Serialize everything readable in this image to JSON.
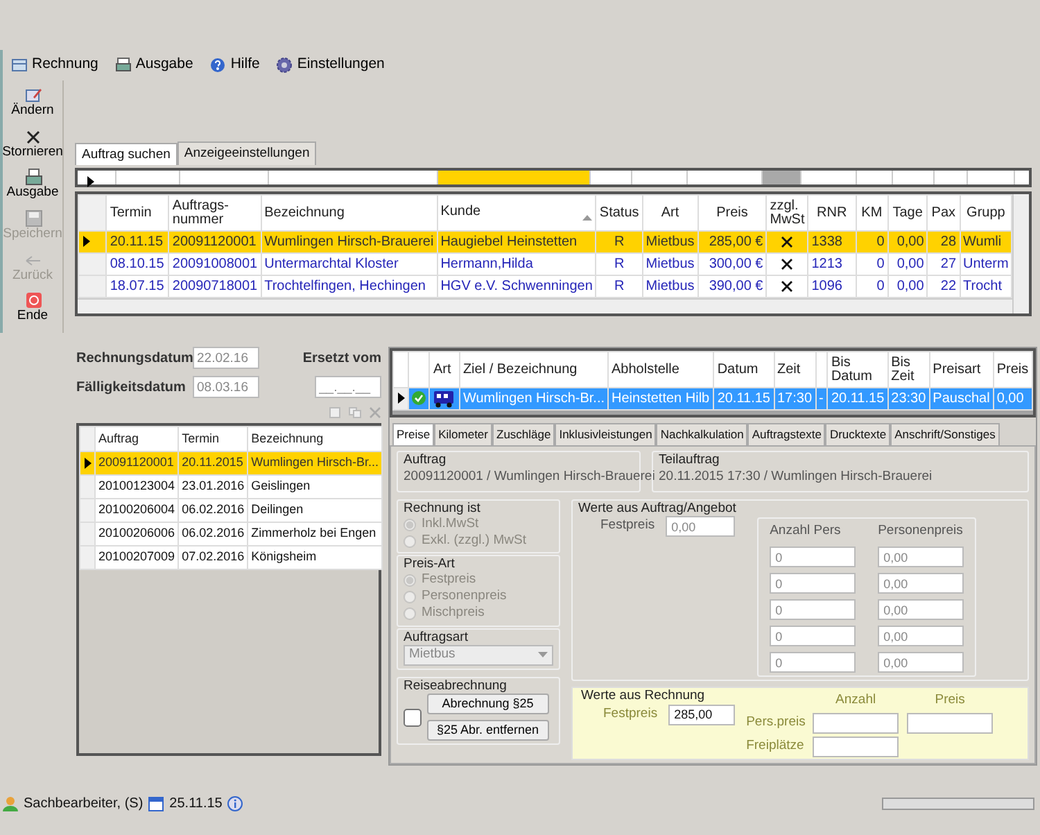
{
  "menu": [
    {
      "label": "Rechnung"
    },
    {
      "label": "Ausgabe"
    },
    {
      "label": "Hilfe"
    },
    {
      "label": "Einstellungen"
    }
  ],
  "toolbar": [
    {
      "label": "Ändern",
      "disabled": false
    },
    {
      "label": "Stornieren",
      "disabled": false
    },
    {
      "label": "Ausgabe",
      "disabled": false
    },
    {
      "label": "Speichern",
      "disabled": true
    },
    {
      "label": "Zurück",
      "disabled": true
    },
    {
      "label": "Ende",
      "disabled": false
    }
  ],
  "search_tabs": [
    {
      "label": "Auftrag suchen",
      "selected": true
    },
    {
      "label": "Anzeigeeinstellungen",
      "selected": false
    }
  ],
  "filter_cells": [
    {
      "kind": "blank"
    },
    {
      "kind": "blank"
    },
    {
      "kind": "blank"
    },
    {
      "kind": "active"
    },
    {
      "kind": "blank"
    },
    {
      "kind": "blank"
    },
    {
      "kind": "blank"
    },
    {
      "kind": "inactive"
    },
    {
      "kind": "blank"
    },
    {
      "kind": "blank"
    },
    {
      "kind": "blank"
    },
    {
      "kind": "blank"
    },
    {
      "kind": "blank"
    }
  ],
  "orders": {
    "columns": [
      {
        "label": "Termin"
      },
      {
        "label": "Auftrags-\nnummer"
      },
      {
        "label": "Bezeichnung"
      },
      {
        "label": "Kunde",
        "sorted": true
      },
      {
        "label": "Status"
      },
      {
        "label": "Art"
      },
      {
        "label": "Preis"
      },
      {
        "label": "zzgl.\nMwSt"
      },
      {
        "label": "RNR"
      },
      {
        "label": "KM"
      },
      {
        "label": "Tage"
      },
      {
        "label": "Pax"
      },
      {
        "label": "Grupp"
      }
    ],
    "rows": [
      {
        "selected": true,
        "termin": "20.11.15",
        "nummer": "20091120001",
        "bezeichnung": "Wumlingen Hirsch-Brauerei",
        "kunde": "Haugiebel Heinstetten",
        "status": "R",
        "art": "Mietbus",
        "preis": "285,00 €",
        "mwst": true,
        "rnr": "1338",
        "km": "0",
        "tage": "0,00",
        "pax": "28",
        "gruppe": "Wumli"
      },
      {
        "selected": false,
        "termin": "08.10.15",
        "nummer": "20091008001",
        "bezeichnung": "Untermarchtal Kloster",
        "kunde": "Hermann,Hilda",
        "status": "R",
        "art": "Mietbus",
        "preis": "300,00 €",
        "mwst": true,
        "rnr": "1213",
        "km": "0",
        "tage": "0,00",
        "pax": "27",
        "gruppe": "Unterm"
      },
      {
        "selected": false,
        "termin": "18.07.15",
        "nummer": "20090718001",
        "bezeichnung": "Trochtelfingen, Hechingen",
        "kunde": "HGV e.V. Schwenningen",
        "status": "R",
        "art": "Mietbus",
        "preis": "390,00 €",
        "mwst": true,
        "rnr": "1096",
        "km": "0",
        "tage": "0,00",
        "pax": "22",
        "gruppe": "Trocht"
      }
    ]
  },
  "invoice": {
    "rechnungsdatum_label": "Rechnungsdatum",
    "rechnungsdatum": "22.02.16",
    "faelligkeit_label": "Fälligkeitsdatum",
    "faelligkeit": "08.03.16",
    "ersetzt_label": "Ersetzt vom",
    "ersetzt": "__.__.__"
  },
  "invoice_orders": {
    "columns": [
      "Auftrag",
      "Termin",
      "Bezeichnung"
    ],
    "rows": [
      {
        "selected": true,
        "cells": [
          "20091120001",
          "20.11.2015",
          "Wumlingen Hirsch-Br..."
        ]
      },
      {
        "selected": false,
        "cells": [
          "20100123004",
          "23.01.2016",
          "Geislingen"
        ]
      },
      {
        "selected": false,
        "cells": [
          "20100206004",
          "06.02.2016",
          "Deilingen"
        ]
      },
      {
        "selected": false,
        "cells": [
          "20100206006",
          "06.02.2016",
          "Zimmerholz bei Engen"
        ]
      },
      {
        "selected": false,
        "cells": [
          "20100207009",
          "07.02.2016",
          "Königsheim"
        ]
      }
    ]
  },
  "positions": {
    "columns": [
      "Art",
      "Ziel / Bezeichnung",
      "Abholstelle",
      "Datum",
      "Zeit",
      "Bis\nDatum",
      "Bis\nZeit",
      "Preisart",
      "Preis"
    ],
    "rows": [
      {
        "selected": true,
        "confirmed": true,
        "ziel": "Wumlingen Hirsch-Br...",
        "abholstelle": "Heinstetten Hilb",
        "datum": "20.11.15",
        "zeit": "17:30",
        "trenner": "-",
        "bis_datum": "20.11.15",
        "bis_zeit": "23:30",
        "preisart": "Pauschal",
        "preis": "0,00"
      }
    ]
  },
  "detail_tabs": [
    {
      "label": "Preise",
      "selected": true
    },
    {
      "label": "Kilometer",
      "selected": false
    },
    {
      "label": "Zuschläge",
      "selected": false
    },
    {
      "label": "Inklusivleistungen",
      "selected": false
    },
    {
      "label": "Nachkalkulation",
      "selected": false
    },
    {
      "label": "Auftragstexte",
      "selected": false
    },
    {
      "label": "Drucktexte",
      "selected": false
    },
    {
      "label": "Anschrift/Sonstiges",
      "selected": false
    }
  ],
  "preise": {
    "auftrag": {
      "title": "Auftrag",
      "value": "20091120001 / Wumlingen Hirsch-Brauerei"
    },
    "teilauftrag": {
      "title": "Teilauftrag",
      "value": "20.11.2015 17:30 / Wumlingen Hirsch-Brauerei"
    },
    "rechnung_ist": {
      "title": "Rechnung ist",
      "disabled": true,
      "options": [
        {
          "label": "Inkl.MwSt",
          "selected": true
        },
        {
          "label": "Exkl. (zzgl.) MwSt",
          "selected": false
        }
      ]
    },
    "preis_art": {
      "title": "Preis-Art",
      "disabled": true,
      "options": [
        {
          "label": "Festpreis",
          "selected": true
        },
        {
          "label": "Personenpreis",
          "selected": false
        },
        {
          "label": "Mischpreis",
          "selected": false
        }
      ]
    },
    "auftragsart": {
      "title": "Auftragsart",
      "value": "Mietbus",
      "disabled": true
    },
    "werte_auftrag": {
      "title": "Werte aus Auftrag/Angebot",
      "festpreis_label": "Festpreis",
      "festpreis": "0,00",
      "anzahl_label": "Anzahl Pers",
      "preis_label": "Personenpreis",
      "rows": [
        {
          "anzahl": "0",
          "preis": "0,00"
        },
        {
          "anzahl": "0",
          "preis": "0,00"
        },
        {
          "anzahl": "0",
          "preis": "0,00"
        },
        {
          "anzahl": "0",
          "preis": "0,00"
        },
        {
          "anzahl": "0",
          "preis": "0,00"
        }
      ]
    },
    "reiseabrechnung": {
      "title": "Reiseabrechnung",
      "checked": false,
      "buttons": [
        "Abrechnung §25",
        "§25 Abr. entfernen"
      ]
    },
    "werte_rechnung": {
      "title": "Werte aus Rechnung",
      "festpreis_label": "Festpreis",
      "festpreis": "285,00",
      "anzahl_label": "Anzahl",
      "preis_label": "Preis",
      "rows": [
        {
          "label": "Pers.preis"
        },
        {
          "label": "Freiplätze"
        }
      ]
    }
  },
  "status_bar": {
    "user": "Sachbearbeiter, (S)",
    "date": "25.11.15",
    "progress": {
      "level": 0
    }
  }
}
